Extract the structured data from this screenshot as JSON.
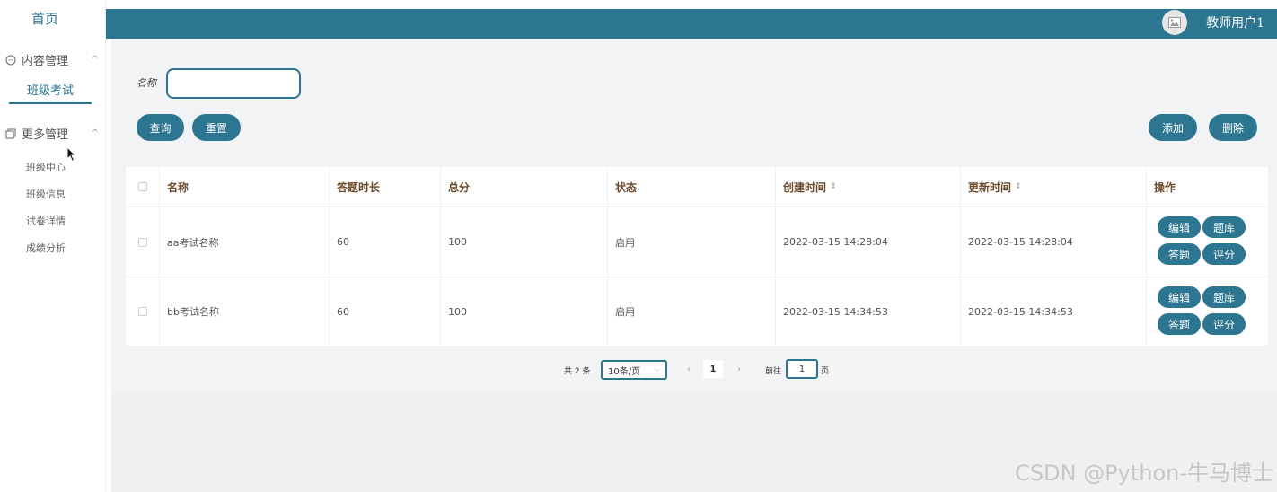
{
  "sidebar": {
    "home": "首页",
    "group1": {
      "label": "内容管理",
      "chevron": "^"
    },
    "active_item": "班级考试",
    "group2": {
      "label": "更多管理",
      "chevron": "^"
    },
    "sub_items": [
      "班级中心",
      "班级信息",
      "试卷详情",
      "成绩分析"
    ]
  },
  "header": {
    "username": "教师用户1",
    "bg_color": "#2c7691"
  },
  "search": {
    "label": "名称",
    "value": "",
    "query_button": "查询",
    "reset_button": "重置"
  },
  "actions": {
    "add": "添加",
    "delete": "删除"
  },
  "table": {
    "columns": [
      "名称",
      "答题时长",
      "总分",
      "状态",
      "创建时间",
      "更新时间",
      "操作"
    ],
    "sort_icon": "⇕",
    "rows": [
      {
        "name": "aa考试名称",
        "duration": "60",
        "total": "100",
        "status": "启用",
        "created": "2022-03-15 14:28:04",
        "updated": "2022-03-15 14:28:04"
      },
      {
        "name": "bb考试名称",
        "duration": "60",
        "total": "100",
        "status": "启用",
        "created": "2022-03-15 14:34:53",
        "updated": "2022-03-15 14:34:53"
      }
    ],
    "row_actions": [
      "编辑",
      "题库",
      "答题",
      "评分"
    ]
  },
  "pagination": {
    "total": "共 2 条",
    "page_size": "10条/页",
    "prev": "‹",
    "current": "1",
    "next": "›",
    "goto_prefix": "前往",
    "goto_value": "1",
    "goto_suffix": "页"
  },
  "watermark": "CSDN @Python-牛马博士"
}
